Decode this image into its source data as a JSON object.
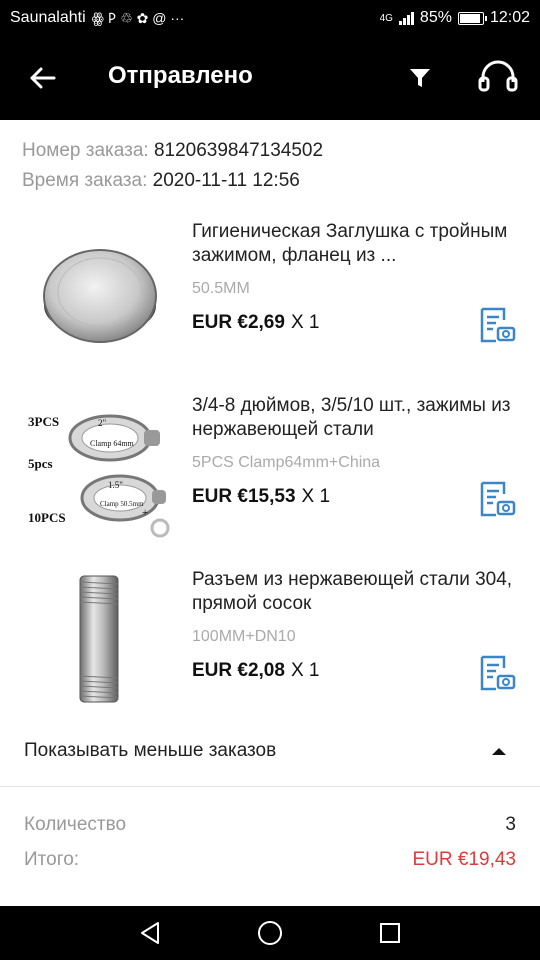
{
  "status_bar": {
    "carrier": "Saunalahti",
    "notification_icons": "ꙮ 𐌓 ♲ ✿ @ ···",
    "network": "4G",
    "battery_percent": "85%",
    "time": "12:02"
  },
  "header": {
    "title": "Отправлено"
  },
  "order": {
    "number_label": "Номер заказа:",
    "number_value": "8120639847134502",
    "time_label": "Время заказа:",
    "time_value": "2020-11-11 12:56"
  },
  "products": [
    {
      "title": "Гигиеническая Заглушка с тройным зажимом, фланец из ...",
      "variant": "50.5MM",
      "price": "EUR €2,69",
      "qty": "X 1"
    },
    {
      "title": "3/4-8 дюймов, 3/5/10 шт., зажимы из нержавеющей стали",
      "variant": "5PCS Clamp64mm+China",
      "price": "EUR €15,53",
      "qty": "X 1",
      "image_labels": [
        "3PCS",
        "5pcs",
        "10PCS",
        "2\"",
        "Clamp 64mm",
        "1.5\"",
        "Clamp 50.5mm",
        "+"
      ]
    },
    {
      "title": "Разъем из нержавеющей стали 304, прямой сосок",
      "variant": "100MM+DN10",
      "price": "EUR €2,08",
      "qty": "X 1"
    }
  ],
  "show_less_label": "Показывать меньше заказов",
  "summary": {
    "quantity_label": "Количество",
    "quantity_value": "3",
    "total_label": "Итого:",
    "total_value": "EUR €19,43"
  },
  "colors": {
    "header_bg": "#000000",
    "accent_blue": "#3a86c8",
    "total_red": "#e03a3a",
    "muted_text": "#999999"
  },
  "icons": {
    "back": "arrow-left-icon",
    "filter": "filter-icon",
    "support": "headset-icon",
    "product_action": "document-camera-icon",
    "show_less": "caret-up-icon",
    "nav_back": "triangle-back-icon",
    "nav_home": "circle-home-icon",
    "nav_recents": "square-recents-icon"
  }
}
